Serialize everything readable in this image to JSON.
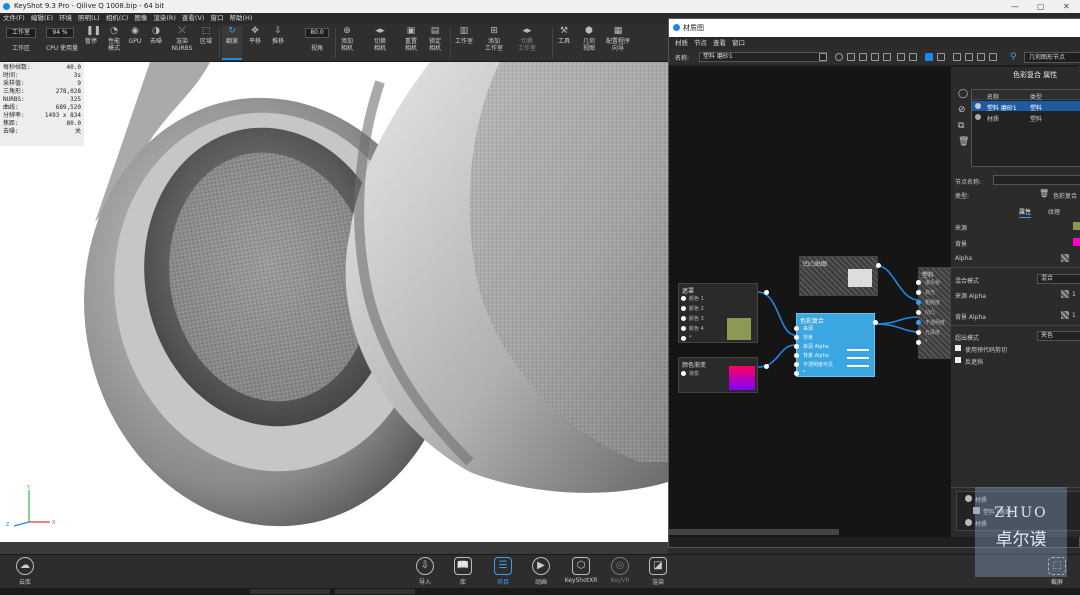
{
  "window": {
    "title": "KeyShot 9.3 Pro  - Qilive Q 1008.bip  - 64 bit",
    "min": "—",
    "max": "▢",
    "close": "✕"
  },
  "menu": [
    "文件(F)",
    "编辑(E)",
    "环境",
    "照明(L)",
    "相机(C)",
    "图像",
    "渲染(R)",
    "查看(V)",
    "窗口",
    "帮助(H)"
  ],
  "toolbar": {
    "workspace": "工作室",
    "workspace_label": "工作区",
    "cpu": "CPU 使用量",
    "cpu_value": "94 %",
    "pause": "暂停",
    "performance": "性能\n模式",
    "gpu": "GPU",
    "denoise": "去噪",
    "render_nurbs": "渲染\nNURBS",
    "region": "区域",
    "tumble": "翻滚",
    "pan": "平移",
    "dolly": "推移",
    "fov_value": "80.0",
    "perspective": "视角",
    "add_camera": "添加\n相机",
    "switch_camera": "切换\n相机",
    "reset_camera": "重置\n相机",
    "lock_camera": "锁定\n相机",
    "studio": "工作室",
    "add_studio": "添加\n工作室",
    "switch_studio": "切换\n工作室",
    "tools": "工具",
    "geometry_view": "几何\n视图",
    "config": "配置程序\n向导"
  },
  "stats": [
    [
      "每秒帧数:",
      "40.0"
    ],
    [
      "时间:",
      "3s"
    ],
    [
      "采样值:",
      "9"
    ],
    [
      "三角形:",
      "278,028"
    ],
    [
      "NURBS:",
      "325"
    ],
    [
      "曲线:",
      "689,520"
    ],
    [
      "分辨率:",
      "1493 x 834"
    ],
    [
      "焦距:",
      "80.0"
    ],
    [
      "去噪:",
      "关"
    ]
  ],
  "bottom": {
    "cloud": "云库",
    "import": "导入",
    "library": "库",
    "project": "项目",
    "animation": "动画",
    "keyshotxr": "KeyShotXR",
    "keyvr": "KeyVR",
    "render": "渲染",
    "screenshot": "截屏"
  },
  "material": {
    "title": "材质图",
    "menu": [
      "材质",
      "节点",
      "查看",
      "窗口"
    ],
    "name_label": "名称:",
    "name_value": "塑料 磨砂1",
    "geometry_node": "几何图形节点",
    "props_title": "色彩复合 属性",
    "col_name": "名称",
    "col_type": "类型",
    "rows": [
      [
        "塑料 磨砂1",
        "塑料"
      ],
      [
        "材质",
        "塑料"
      ]
    ],
    "node_name_label": "节点名称:",
    "type_label": "类型:",
    "type_value": "色彩复合",
    "tab_props": "属性",
    "tab_texture": "纹理",
    "source": "来源",
    "background": "背景",
    "alpha": "Alpha",
    "blend_mode": "混合模式",
    "blend_value": "混合",
    "source_alpha": "来源 Alpha",
    "source_alpha_value": "1",
    "bg_alpha": "背景 Alpha",
    "bg_alpha_value": "1",
    "clip_mode": "超出模式",
    "clip_value": "夹色",
    "use_alpha_clip": "使用预代码剪切",
    "invert": "反遮挡",
    "tree_material": "材质",
    "tree_plastic": "塑料 (表面)",
    "tree_material2": "材质"
  },
  "nodes": {
    "mix": {
      "title": "遮罩",
      "ports": [
        "颜色 1",
        "颜色 2",
        "颜色 3",
        "颜色 4",
        "*"
      ]
    },
    "gradient": {
      "title": "颜色渐变",
      "port": "渐变"
    },
    "composite": {
      "title": "色彩复合",
      "ports": [
        "来源",
        "背景",
        "来源 Alpha",
        "背景 Alpha",
        "不透明度可见",
        "*"
      ]
    },
    "noise": {
      "title": "凹凸贴图"
    },
    "output": {
      "title": "塑料",
      "ports": [
        "漫反射",
        "高光",
        "粗糙度",
        "凹凸",
        "不透明度",
        "光泽度",
        "*"
      ]
    }
  },
  "watermark": {
    "line1": "ZHUO",
    "line2": "卓尔谟"
  },
  "colors": {
    "accent": "#1e88e5",
    "node_selected": "#3aa7e0"
  }
}
